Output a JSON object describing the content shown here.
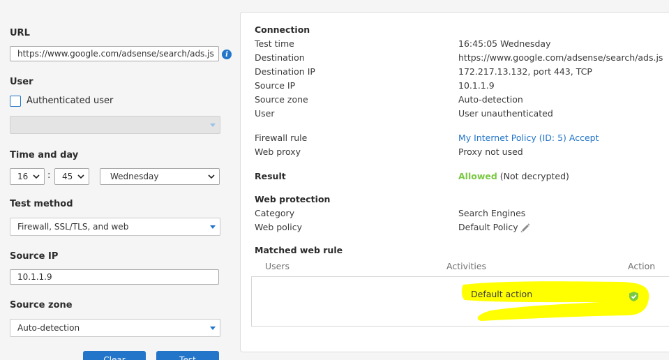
{
  "form": {
    "url_label": "URL",
    "url_value": "https://www.google.com/adsense/search/ads.js",
    "info_icon_glyph": "i",
    "user_label": "User",
    "authenticated_user_label": "Authenticated user",
    "authenticated_user_checked": false,
    "user_select_value": "",
    "time_label": "Time and day",
    "hour": "16",
    "time_separator": ":",
    "minute": "45",
    "day": "Wednesday",
    "test_method_label": "Test method",
    "test_method_value": "Firewall, SSL/TLS, and web",
    "source_ip_label": "Source IP",
    "source_ip_value": "10.1.1.9",
    "source_zone_label": "Source zone",
    "source_zone_value": "Auto-detection",
    "clear_button": "Clear",
    "test_button": "Test"
  },
  "result": {
    "connection": {
      "heading": "Connection",
      "rows": [
        {
          "key": "Test time",
          "value": "16:45:05 Wednesday"
        },
        {
          "key": "Destination",
          "value": "https://www.google.com/adsense/search/ads.js"
        },
        {
          "key": "Destination IP",
          "value": "172.217.13.132, port 443, TCP"
        },
        {
          "key": "Source IP",
          "value": "10.1.1.9"
        },
        {
          "key": "Source zone",
          "value": "Auto-detection"
        },
        {
          "key": "User",
          "value": "User unauthenticated"
        }
      ]
    },
    "firewall_rule_label": "Firewall rule",
    "firewall_rule_value": "My Internet Policy (ID: 5) Accept",
    "web_proxy_label": "Web proxy",
    "web_proxy_value": "Proxy not used",
    "result_label": "Result",
    "result_status": "Allowed",
    "result_detail": "(Not decrypted)",
    "web_protection": {
      "heading": "Web protection",
      "category_label": "Category",
      "category_value": "Search Engines",
      "web_policy_label": "Web policy",
      "web_policy_value": "Default Policy"
    },
    "matched_rule": {
      "heading": "Matched web rule",
      "columns": [
        "Users",
        "Activities",
        "Action"
      ],
      "row_activity": "Default action",
      "row_action_icon": "shield-check-icon"
    }
  },
  "colors": {
    "accent": "#2275c9",
    "allowed": "#7ac943",
    "highlight": "#ffff00"
  }
}
